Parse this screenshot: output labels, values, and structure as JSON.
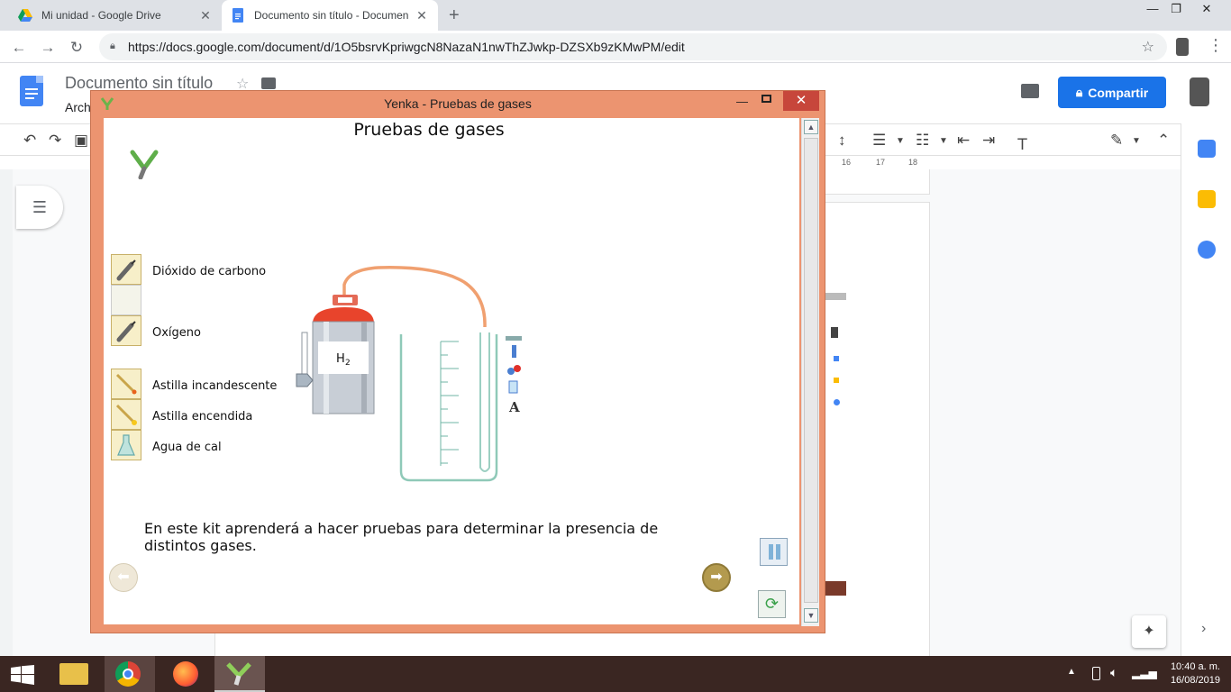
{
  "browser": {
    "tabs": [
      {
        "title": "Mi unidad - Google Drive",
        "active": false
      },
      {
        "title": "Documento sin título - Documen",
        "active": true
      }
    ],
    "url": "https://docs.google.com/document/d/1O5bsrvKpriwgcN8NazaN1nwThZJwkp-DZSXb9zKMwPM/edit"
  },
  "docs": {
    "title": "Documento sin título",
    "menu_file": "Arch",
    "share_label": "Compartir",
    "ruler_marks": [
      "16",
      "17",
      "18"
    ]
  },
  "yenka": {
    "window_title": "Yenka - Pruebas de gases",
    "scene_title": "Pruebas de gases",
    "tools": [
      {
        "label": "Dióxido de carbono",
        "icon": "gas-canister-icon"
      },
      {
        "label": "",
        "icon": ""
      },
      {
        "label": "Oxígeno",
        "icon": "gas-canister-icon"
      },
      {
        "label": "Astilla incandescente",
        "icon": "glowing-splint-icon"
      },
      {
        "label": "Astilla encendida",
        "icon": "lit-splint-icon"
      },
      {
        "label": "Agua de cal",
        "icon": "limewater-flask-icon"
      }
    ],
    "cylinder_label_main": "H",
    "cylinder_label_sub": "2",
    "description": "En este kit aprenderá a hacer pruebas para determinar la presencia de distintos gases."
  },
  "taskbar": {
    "time": "10:40 a. m.",
    "date": "16/08/2019"
  },
  "colors": {
    "yenka_frame": "#ec9470",
    "docs_blue": "#1a73e8",
    "cylinder_cap": "#e8442c",
    "tube": "#f0a070",
    "beaker": "#8fc9b8"
  }
}
